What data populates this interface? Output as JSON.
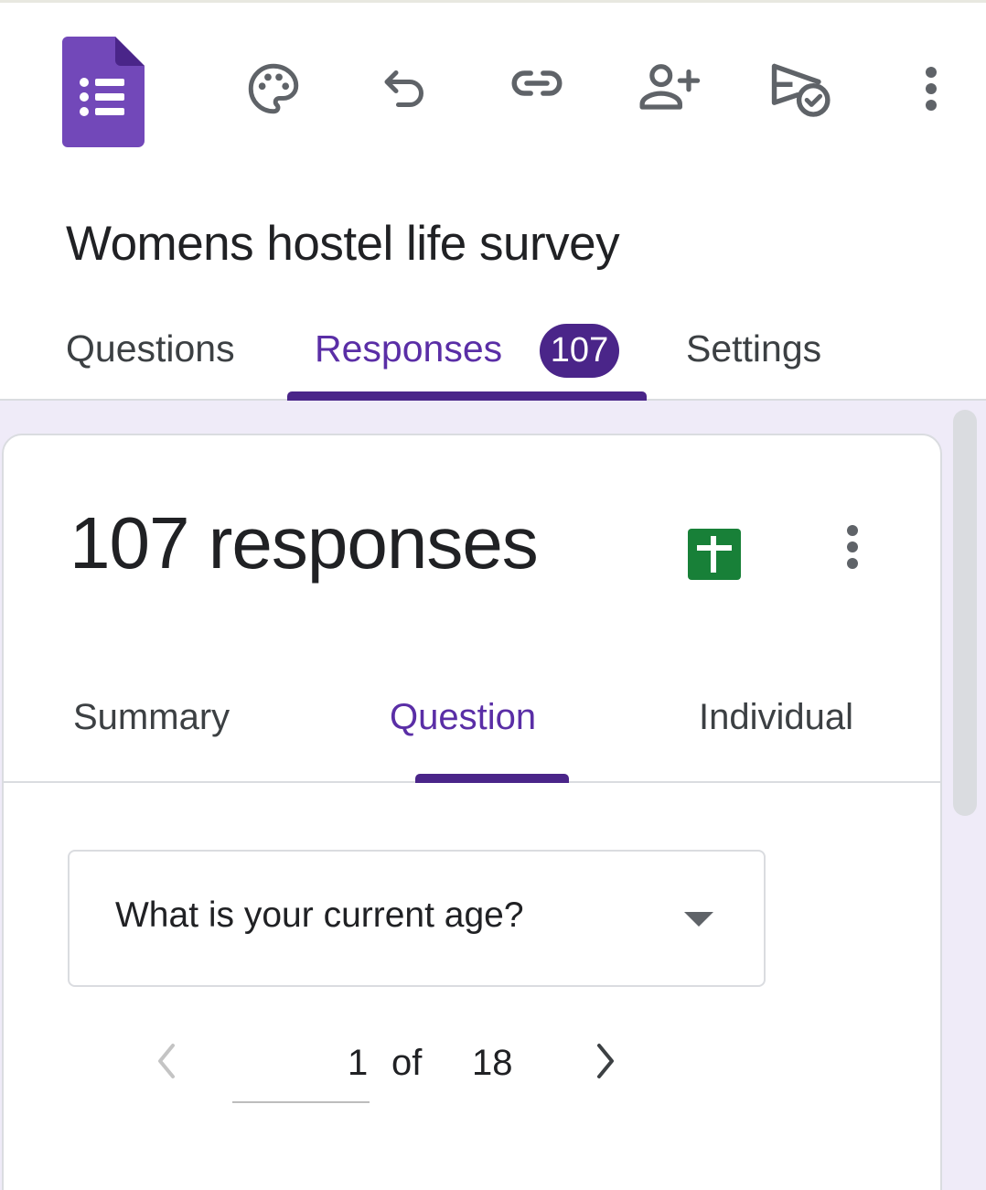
{
  "toolbar": {
    "app_icon": "google-forms-icon",
    "icons": [
      "palette-icon",
      "undo-icon",
      "link-icon",
      "add-collaborator-icon",
      "send-icon",
      "more-vert-icon"
    ]
  },
  "form": {
    "title": "Womens hostel life survey"
  },
  "tabs": {
    "questions": "Questions",
    "responses": "Responses",
    "responses_badge": "107",
    "settings": "Settings",
    "active": "responses"
  },
  "responses": {
    "count_text": "107 responses",
    "sheets_icon": "google-sheets-icon",
    "more_icon": "more-vert-icon"
  },
  "subtabs": {
    "summary": "Summary",
    "question": "Question",
    "individual": "Individual",
    "active": "question"
  },
  "question_select": {
    "selected": "What is your current age?"
  },
  "pager": {
    "current": "1",
    "of": "of",
    "total": "18"
  },
  "colors": {
    "accent": "#5a2ea6",
    "badge_bg": "#4a2589",
    "forms_purple": "#7248b9",
    "sheets_green": "#188038",
    "background_tint": "#efebf8"
  }
}
